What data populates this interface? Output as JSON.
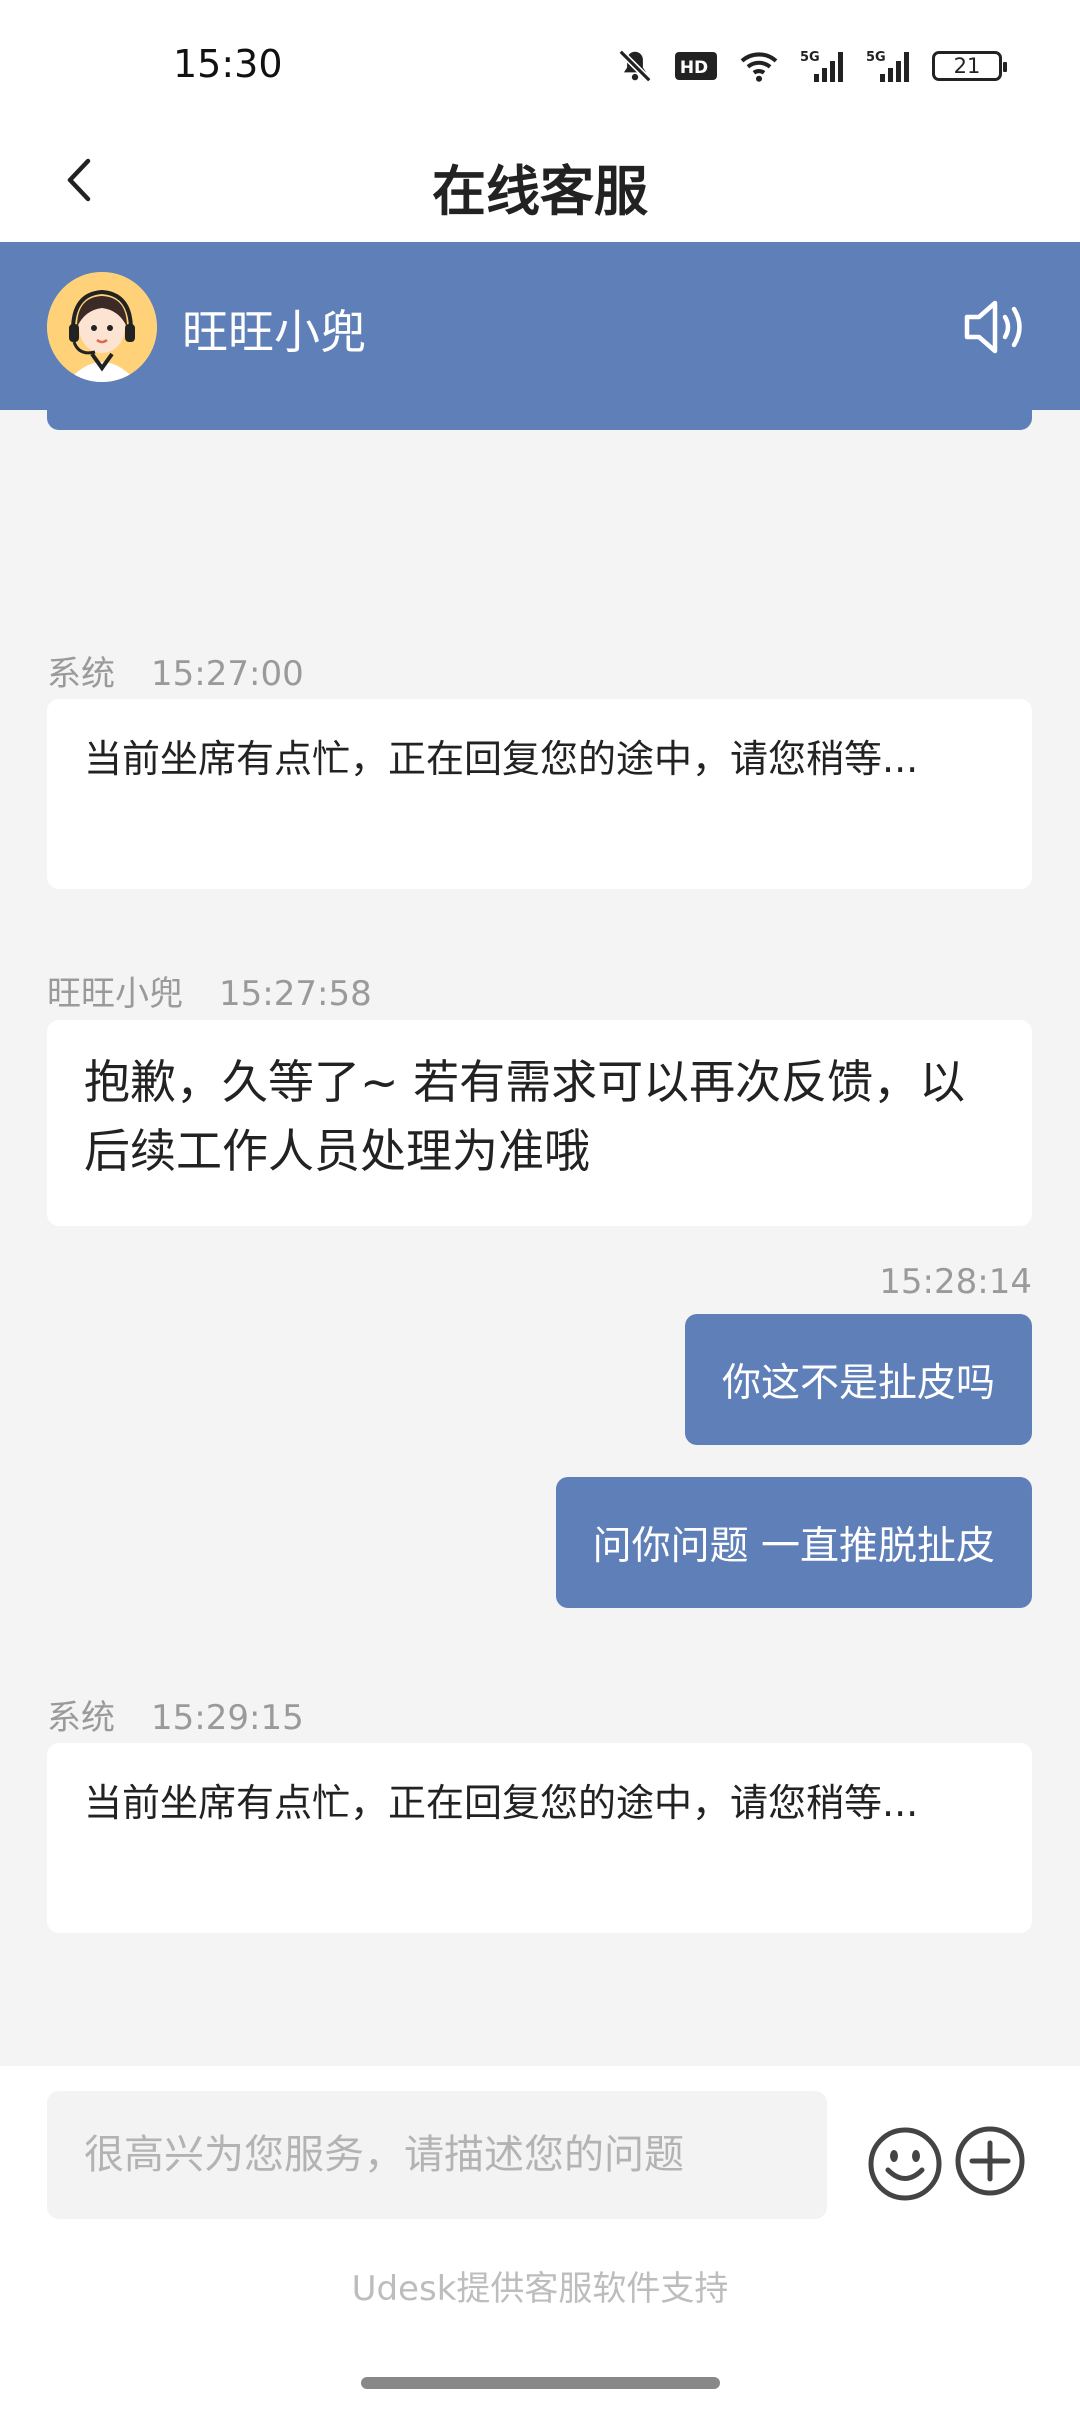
{
  "status_bar": {
    "time": "15:30",
    "signal_1": "5G",
    "signal_2": "5G",
    "hd_badge": "HD",
    "battery_level": "21"
  },
  "nav": {
    "title": "在线客服"
  },
  "agent": {
    "name": "旺旺小兜"
  },
  "messages": [
    {
      "side": "left",
      "sender": "系统",
      "time": "15:27:00",
      "text": "当前坐席有点忙，正在回复您的途中，请您稍等..."
    },
    {
      "side": "left",
      "sender": "旺旺小兜",
      "time": "15:27:58",
      "text": "抱歉，久等了~ 若有需求可以再次反馈，以后续工作人员处理为准哦"
    },
    {
      "side": "right",
      "time": "15:28:14",
      "text": "你这不是扯皮吗"
    },
    {
      "side": "right",
      "text": "问你问题 一直推脱扯皮"
    },
    {
      "side": "left",
      "sender": "系统",
      "time": "15:29:15",
      "text": "当前坐席有点忙，正在回复您的途中，请您稍等..."
    }
  ],
  "input": {
    "placeholder": "很高兴为您服务，请描述您的问题",
    "value": ""
  },
  "footer": {
    "powered_by": "Udesk提供客服软件支持"
  },
  "colors": {
    "accent": "#5f7fb9",
    "background": "#f4f4f4",
    "bubble_left": "#ffffff",
    "meta_text": "#9a9a9a"
  },
  "icons": [
    "back-arrow-icon",
    "speaker-icon",
    "emoji-icon",
    "plus-icon",
    "mute-icon",
    "wifi-icon",
    "signal-icon",
    "battery-icon"
  ]
}
